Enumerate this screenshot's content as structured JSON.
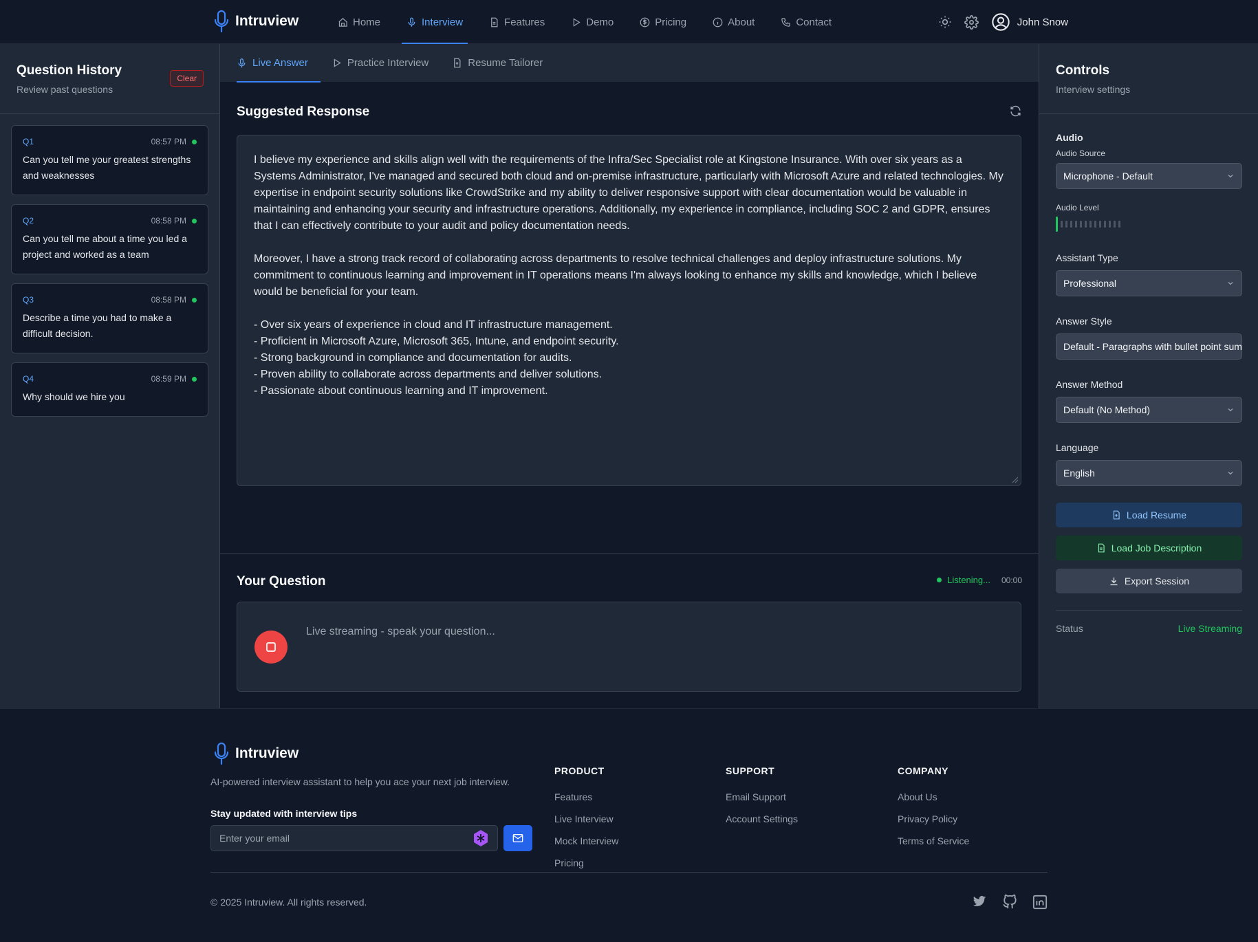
{
  "app": {
    "name": "Intruview"
  },
  "nav": {
    "items": [
      {
        "label": "Home",
        "icon": "home-icon"
      },
      {
        "label": "Interview",
        "icon": "mic-icon",
        "active": true
      },
      {
        "label": "Features",
        "icon": "document-icon"
      },
      {
        "label": "Demo",
        "icon": "play-icon"
      },
      {
        "label": "Pricing",
        "icon": "dollar-icon"
      },
      {
        "label": "About",
        "icon": "info-icon"
      },
      {
        "label": "Contact",
        "icon": "phone-icon"
      }
    ],
    "user_name": "John Snow"
  },
  "history": {
    "title": "Question History",
    "subtitle": "Review past questions",
    "clear_label": "Clear",
    "items": [
      {
        "id": "Q1",
        "time": "08:57 PM",
        "text": "Can you tell me your greatest strengths and weaknesses"
      },
      {
        "id": "Q2",
        "time": "08:58 PM",
        "text": "Can you tell me about a time you led a project and worked as a team"
      },
      {
        "id": "Q3",
        "time": "08:58 PM",
        "text": "Describe a time you had to make a difficult decision."
      },
      {
        "id": "Q4",
        "time": "08:59 PM",
        "text": "Why should we hire you"
      }
    ]
  },
  "tabs": [
    {
      "label": "Live Answer",
      "active": true
    },
    {
      "label": "Practice Interview"
    },
    {
      "label": "Resume Tailorer"
    }
  ],
  "response": {
    "title": "Suggested Response",
    "paragraph1": "I believe my experience and skills align well with the requirements of the Infra/Sec Specialist role at Kingstone Insurance. With over six years as a Systems Administrator, I've managed and secured both cloud and on-premise infrastructure, particularly with Microsoft Azure and related technologies. My expertise in endpoint security solutions like CrowdStrike and my ability to deliver responsive support with clear documentation would be valuable in maintaining and enhancing your security and infrastructure operations. Additionally, my experience in compliance, including SOC 2 and GDPR, ensures that I can effectively contribute to your audit and policy documentation needs.",
    "paragraph2": "Moreover, I have a strong track record of collaborating across departments to resolve technical challenges and deploy infrastructure solutions. My commitment to continuous learning and improvement in IT operations means I'm always looking to enhance my skills and knowledge, which I believe would be beneficial for your team.",
    "bullets": [
      "- Over six years of experience in cloud and IT infrastructure management.",
      "- Proficient in Microsoft Azure, Microsoft 365, Intune, and endpoint security.",
      "- Strong background in compliance and documentation for audits.",
      "- Proven ability to collaborate across departments and deliver solutions.",
      "- Passionate about continuous learning and IT improvement."
    ]
  },
  "question": {
    "title": "Your Question",
    "status": "Listening...",
    "timer": "00:00",
    "placeholder": "Live streaming - speak your question..."
  },
  "controls": {
    "title": "Controls",
    "subtitle": "Interview settings",
    "audio_heading": "Audio",
    "audio_source_label": "Audio Source",
    "audio_source_value": "Microphone - Default",
    "audio_level_label": "Audio Level",
    "audio_level": 0.07,
    "assistant_type_label": "Assistant Type",
    "assistant_type_value": "Professional",
    "answer_style_label": "Answer Style",
    "answer_style_value": "Default - Paragraphs with bullet point summary",
    "answer_method_label": "Answer Method",
    "answer_method_value": "Default (No Method)",
    "language_label": "Language",
    "language_value": "English",
    "load_resume_label": "Load Resume",
    "load_job_label": "Load Job Description",
    "export_label": "Export Session",
    "status_label": "Status",
    "status_value": "Live Streaming"
  },
  "footer": {
    "brand": "Intruview",
    "description": "AI-powered interview assistant to help you ace your next job interview.",
    "newsletter_title": "Stay updated with interview tips",
    "email_placeholder": "Enter your email",
    "columns": [
      {
        "title": "PRODUCT",
        "links": [
          "Features",
          "Live Interview",
          "Mock Interview",
          "Pricing"
        ]
      },
      {
        "title": "SUPPORT",
        "links": [
          "Email Support",
          "Account Settings"
        ]
      },
      {
        "title": "COMPANY",
        "links": [
          "About Us",
          "Privacy Policy",
          "Terms of Service"
        ]
      }
    ],
    "copyright": "© 2025 Intruview. All rights reserved."
  },
  "colors": {
    "accent": "#3b82f6",
    "live": "#22c55e",
    "danger": "#ef4444"
  }
}
